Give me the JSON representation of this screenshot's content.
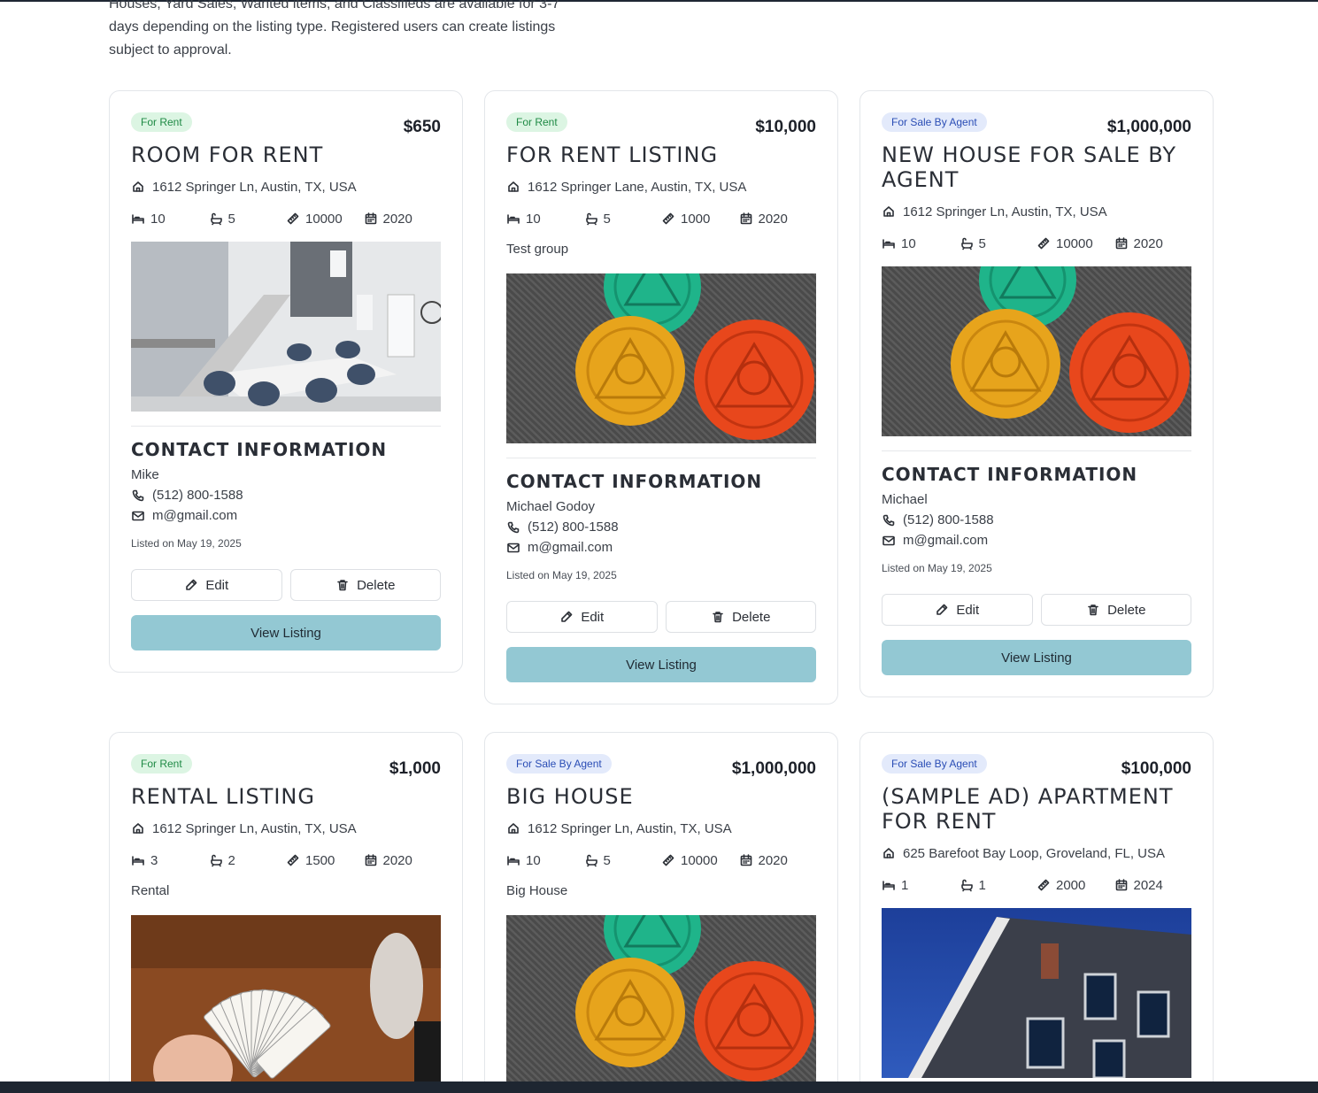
{
  "intro_text": "Houses, Yard Sales, Wanted items, and Classifieds are available for 3-7 days depending on the listing type. Registered users can create listings subject to approval.",
  "labels": {
    "contact_title": "Contact Information",
    "listed_prefix": "Listed on",
    "edit": "Edit",
    "delete": "Delete",
    "view": "View Listing"
  },
  "icons": [
    "home-icon",
    "bed-icon",
    "bath-icon",
    "ruler-icon",
    "calendar-icon",
    "phone-icon",
    "mail-icon",
    "pencil-icon",
    "trash-icon"
  ],
  "colors": {
    "rent_badge_bg": "#dcf5e3",
    "rent_badge_text": "#1f8a45",
    "sale_badge_bg": "#e3eafb",
    "sale_badge_text": "#2a4db5",
    "view_button": "#93c8d3"
  },
  "listings": [
    {
      "badge": "For Rent",
      "badge_type": "rent",
      "price": "$650",
      "title": "Room for rent",
      "address": "1612 Springer Ln, Austin, TX, USA",
      "beds": "10",
      "baths": "5",
      "sqft": "10000",
      "year": "2020",
      "description": "",
      "photo": "interior",
      "contact_name": "Mike",
      "phone": "(512) 800-1588",
      "email": "m@gmail.com",
      "listed": "Listed on May 19, 2025"
    },
    {
      "badge": "For Rent",
      "badge_type": "rent",
      "price": "$10,000",
      "title": "For rent listing",
      "address": "1612 Springer Lane, Austin, TX, USA",
      "beds": "10",
      "baths": "5",
      "sqft": "1000",
      "year": "2020",
      "description": "Test group",
      "photo": "coins",
      "contact_name": "Michael Godoy",
      "phone": "(512) 800-1588",
      "email": "m@gmail.com",
      "listed": "Listed on May 19, 2025"
    },
    {
      "badge": "For Sale By Agent",
      "badge_type": "sale",
      "price": "$1,000,000",
      "title": "New house for sale by agent",
      "address": "1612 Springer Ln, Austin, TX, USA",
      "beds": "10",
      "baths": "5",
      "sqft": "10000",
      "year": "2020",
      "description": "",
      "photo": "coins",
      "contact_name": "Michael",
      "phone": "(512) 800-1588",
      "email": "m@gmail.com",
      "listed": "Listed on May 19, 2025"
    },
    {
      "badge": "For Rent",
      "badge_type": "rent",
      "price": "$1,000",
      "title": "Rental listing",
      "address": "1612 Springer Ln, Austin, TX, USA",
      "beds": "3",
      "baths": "2",
      "sqft": "1500",
      "year": "2020",
      "description": "Rental",
      "photo": "cards"
    },
    {
      "badge": "For Sale By Agent",
      "badge_type": "sale",
      "price": "$1,000,000",
      "title": "Big House",
      "address": "1612 Springer Ln, Austin, TX, USA",
      "beds": "10",
      "baths": "5",
      "sqft": "10000",
      "year": "2020",
      "description": "Big House",
      "photo": "coins"
    },
    {
      "badge": "For Sale By Agent",
      "badge_type": "sale",
      "price": "$100,000",
      "title": "(Sample Ad) Apartment for rent",
      "address": "625 Barefoot Bay Loop, Groveland, FL, USA",
      "beds": "1",
      "baths": "1",
      "sqft": "2000",
      "year": "2024",
      "description": "",
      "photo": "building"
    }
  ]
}
